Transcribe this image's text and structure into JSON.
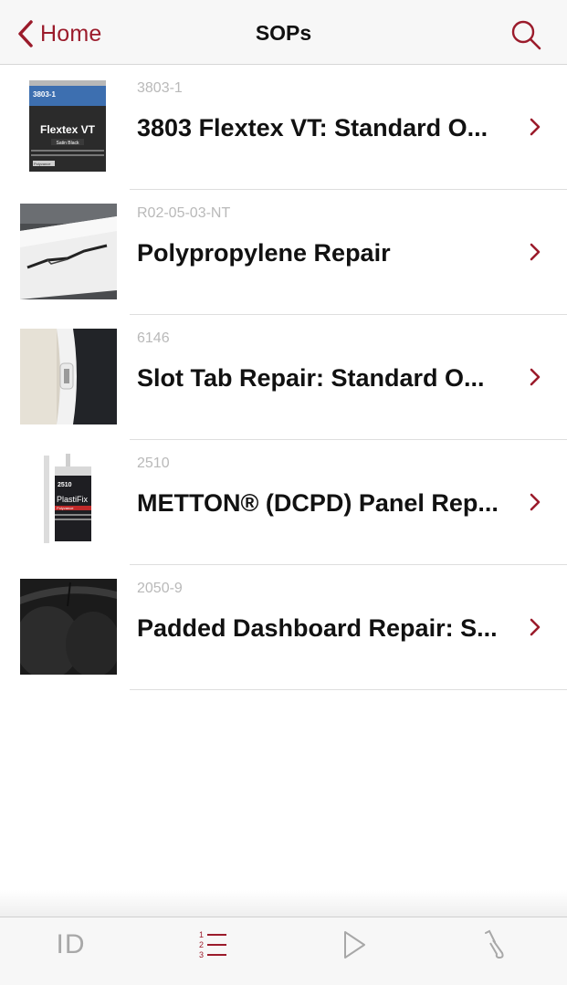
{
  "navbar": {
    "back_label": "Home",
    "title": "SOPs",
    "back_icon": "chevron-left-icon",
    "search_icon": "search-icon"
  },
  "colors": {
    "accent": "#9b1b2b",
    "code_gray": "#b9b9b9",
    "separator": "#dedede",
    "bar_bg": "#f7f7f7"
  },
  "items": [
    {
      "code": "3803-1",
      "title": "3803 Flextex VT: Standard O...",
      "thumb": "flextex-can-photo",
      "thumb_text": {
        "product": "3803-1",
        "name": "Flextex VT",
        "finish": "Satin Black",
        "brand": "Polyvance"
      }
    },
    {
      "code": "R02-05-03-NT",
      "title": "Polypropylene Repair",
      "thumb": "cracked-bumper-photo"
    },
    {
      "code": "6146",
      "title": "Slot Tab Repair:  Standard O...",
      "thumb": "slot-tab-photo"
    },
    {
      "code": "2510",
      "title": "METTON® (DCPD) Panel Rep...",
      "thumb": "plastifix-cartridge-photo",
      "thumb_text": {
        "product": "2510",
        "name": "PlastiFix",
        "brand": "Polyvance"
      }
    },
    {
      "code": "2050-9",
      "title": "Padded Dashboard Repair: S...",
      "thumb": "dashboard-photo"
    }
  ],
  "tabbar": {
    "tabs": [
      {
        "label": "ID",
        "icon": "id-text-icon",
        "active": false
      },
      {
        "label": "",
        "icon": "numbered-list-icon",
        "active": true,
        "digits": [
          "1",
          "2",
          "3"
        ]
      },
      {
        "label": "",
        "icon": "play-icon",
        "active": false
      },
      {
        "label": "",
        "icon": "dropper-icon",
        "active": false
      }
    ]
  }
}
